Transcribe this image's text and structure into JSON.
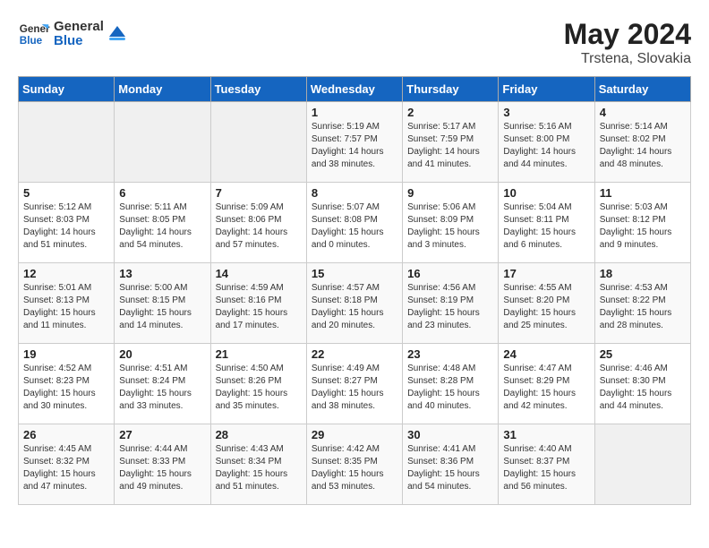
{
  "header": {
    "logo_general": "General",
    "logo_blue": "Blue",
    "month_year": "May 2024",
    "location": "Trstena, Slovakia"
  },
  "days_of_week": [
    "Sunday",
    "Monday",
    "Tuesday",
    "Wednesday",
    "Thursday",
    "Friday",
    "Saturday"
  ],
  "weeks": [
    {
      "days": [
        {
          "num": "",
          "info": ""
        },
        {
          "num": "",
          "info": ""
        },
        {
          "num": "",
          "info": ""
        },
        {
          "num": "1",
          "info": "Sunrise: 5:19 AM\nSunset: 7:57 PM\nDaylight: 14 hours\nand 38 minutes."
        },
        {
          "num": "2",
          "info": "Sunrise: 5:17 AM\nSunset: 7:59 PM\nDaylight: 14 hours\nand 41 minutes."
        },
        {
          "num": "3",
          "info": "Sunrise: 5:16 AM\nSunset: 8:00 PM\nDaylight: 14 hours\nand 44 minutes."
        },
        {
          "num": "4",
          "info": "Sunrise: 5:14 AM\nSunset: 8:02 PM\nDaylight: 14 hours\nand 48 minutes."
        }
      ]
    },
    {
      "days": [
        {
          "num": "5",
          "info": "Sunrise: 5:12 AM\nSunset: 8:03 PM\nDaylight: 14 hours\nand 51 minutes."
        },
        {
          "num": "6",
          "info": "Sunrise: 5:11 AM\nSunset: 8:05 PM\nDaylight: 14 hours\nand 54 minutes."
        },
        {
          "num": "7",
          "info": "Sunrise: 5:09 AM\nSunset: 8:06 PM\nDaylight: 14 hours\nand 57 minutes."
        },
        {
          "num": "8",
          "info": "Sunrise: 5:07 AM\nSunset: 8:08 PM\nDaylight: 15 hours\nand 0 minutes."
        },
        {
          "num": "9",
          "info": "Sunrise: 5:06 AM\nSunset: 8:09 PM\nDaylight: 15 hours\nand 3 minutes."
        },
        {
          "num": "10",
          "info": "Sunrise: 5:04 AM\nSunset: 8:11 PM\nDaylight: 15 hours\nand 6 minutes."
        },
        {
          "num": "11",
          "info": "Sunrise: 5:03 AM\nSunset: 8:12 PM\nDaylight: 15 hours\nand 9 minutes."
        }
      ]
    },
    {
      "days": [
        {
          "num": "12",
          "info": "Sunrise: 5:01 AM\nSunset: 8:13 PM\nDaylight: 15 hours\nand 11 minutes."
        },
        {
          "num": "13",
          "info": "Sunrise: 5:00 AM\nSunset: 8:15 PM\nDaylight: 15 hours\nand 14 minutes."
        },
        {
          "num": "14",
          "info": "Sunrise: 4:59 AM\nSunset: 8:16 PM\nDaylight: 15 hours\nand 17 minutes."
        },
        {
          "num": "15",
          "info": "Sunrise: 4:57 AM\nSunset: 8:18 PM\nDaylight: 15 hours\nand 20 minutes."
        },
        {
          "num": "16",
          "info": "Sunrise: 4:56 AM\nSunset: 8:19 PM\nDaylight: 15 hours\nand 23 minutes."
        },
        {
          "num": "17",
          "info": "Sunrise: 4:55 AM\nSunset: 8:20 PM\nDaylight: 15 hours\nand 25 minutes."
        },
        {
          "num": "18",
          "info": "Sunrise: 4:53 AM\nSunset: 8:22 PM\nDaylight: 15 hours\nand 28 minutes."
        }
      ]
    },
    {
      "days": [
        {
          "num": "19",
          "info": "Sunrise: 4:52 AM\nSunset: 8:23 PM\nDaylight: 15 hours\nand 30 minutes."
        },
        {
          "num": "20",
          "info": "Sunrise: 4:51 AM\nSunset: 8:24 PM\nDaylight: 15 hours\nand 33 minutes."
        },
        {
          "num": "21",
          "info": "Sunrise: 4:50 AM\nSunset: 8:26 PM\nDaylight: 15 hours\nand 35 minutes."
        },
        {
          "num": "22",
          "info": "Sunrise: 4:49 AM\nSunset: 8:27 PM\nDaylight: 15 hours\nand 38 minutes."
        },
        {
          "num": "23",
          "info": "Sunrise: 4:48 AM\nSunset: 8:28 PM\nDaylight: 15 hours\nand 40 minutes."
        },
        {
          "num": "24",
          "info": "Sunrise: 4:47 AM\nSunset: 8:29 PM\nDaylight: 15 hours\nand 42 minutes."
        },
        {
          "num": "25",
          "info": "Sunrise: 4:46 AM\nSunset: 8:30 PM\nDaylight: 15 hours\nand 44 minutes."
        }
      ]
    },
    {
      "days": [
        {
          "num": "26",
          "info": "Sunrise: 4:45 AM\nSunset: 8:32 PM\nDaylight: 15 hours\nand 47 minutes."
        },
        {
          "num": "27",
          "info": "Sunrise: 4:44 AM\nSunset: 8:33 PM\nDaylight: 15 hours\nand 49 minutes."
        },
        {
          "num": "28",
          "info": "Sunrise: 4:43 AM\nSunset: 8:34 PM\nDaylight: 15 hours\nand 51 minutes."
        },
        {
          "num": "29",
          "info": "Sunrise: 4:42 AM\nSunset: 8:35 PM\nDaylight: 15 hours\nand 53 minutes."
        },
        {
          "num": "30",
          "info": "Sunrise: 4:41 AM\nSunset: 8:36 PM\nDaylight: 15 hours\nand 54 minutes."
        },
        {
          "num": "31",
          "info": "Sunrise: 4:40 AM\nSunset: 8:37 PM\nDaylight: 15 hours\nand 56 minutes."
        },
        {
          "num": "",
          "info": ""
        }
      ]
    }
  ]
}
